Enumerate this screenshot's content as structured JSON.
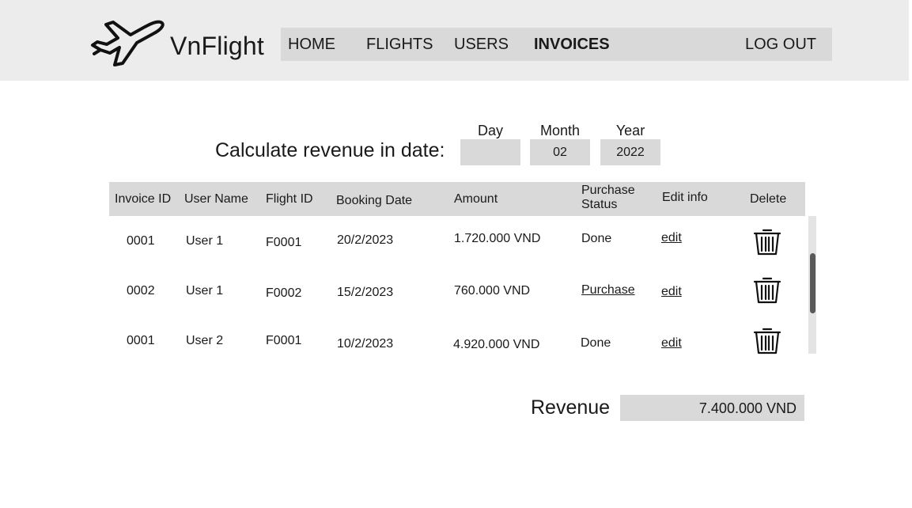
{
  "app": {
    "name": "VnFlight",
    "logo_icon": "airplane-icon"
  },
  "nav": {
    "home": "HOME",
    "flights": "FLIGHTS",
    "users": "USERS",
    "invoices": "INVOICES",
    "logout": "LOG OUT",
    "active": "INVOICES"
  },
  "filter": {
    "title": "Calculate revenue in date:",
    "day_label": "Day",
    "month_label": "Month",
    "year_label": "Year",
    "day_value": "",
    "month_value": "02",
    "year_value": "2022"
  },
  "table": {
    "headers": {
      "invoice_id": "Invoice ID",
      "user_name": "User Name",
      "flight_id": "Flight ID",
      "booking_date": "Booking Date",
      "amount": "Amount",
      "purchase_status_1": "Purchase",
      "purchase_status_2": "Status",
      "edit_info": "Edit info",
      "delete": "Delete"
    },
    "rows": [
      {
        "invoice_id": "0001",
        "user_name": "User 1",
        "flight_id": "F0001",
        "booking_date": "20/2/2023",
        "amount": "1.720.000 VND",
        "status": "Done",
        "edit": "edit",
        "delete_icon": "trash-icon"
      },
      {
        "invoice_id": "0002",
        "user_name": "User 1",
        "flight_id": "F0002",
        "booking_date": "15/2/2023",
        "amount": "760.000 VND",
        "status": "Purchase",
        "edit": "edit",
        "delete_icon": "trash-icon"
      },
      {
        "invoice_id": "0001",
        "user_name": "User 2",
        "flight_id": "F0001",
        "booking_date": "10/2/2023",
        "amount": "4.920.000 VND",
        "status": "Done",
        "edit": "edit",
        "delete_icon": "trash-icon"
      }
    ]
  },
  "revenue": {
    "label": "Revenue",
    "value": "7.400.000 VND"
  },
  "colors": {
    "header_bg": "#ececec",
    "field_bg": "#d9d9d9",
    "text": "#1a1a1a",
    "scroll_thumb": "#5a5a5a"
  }
}
